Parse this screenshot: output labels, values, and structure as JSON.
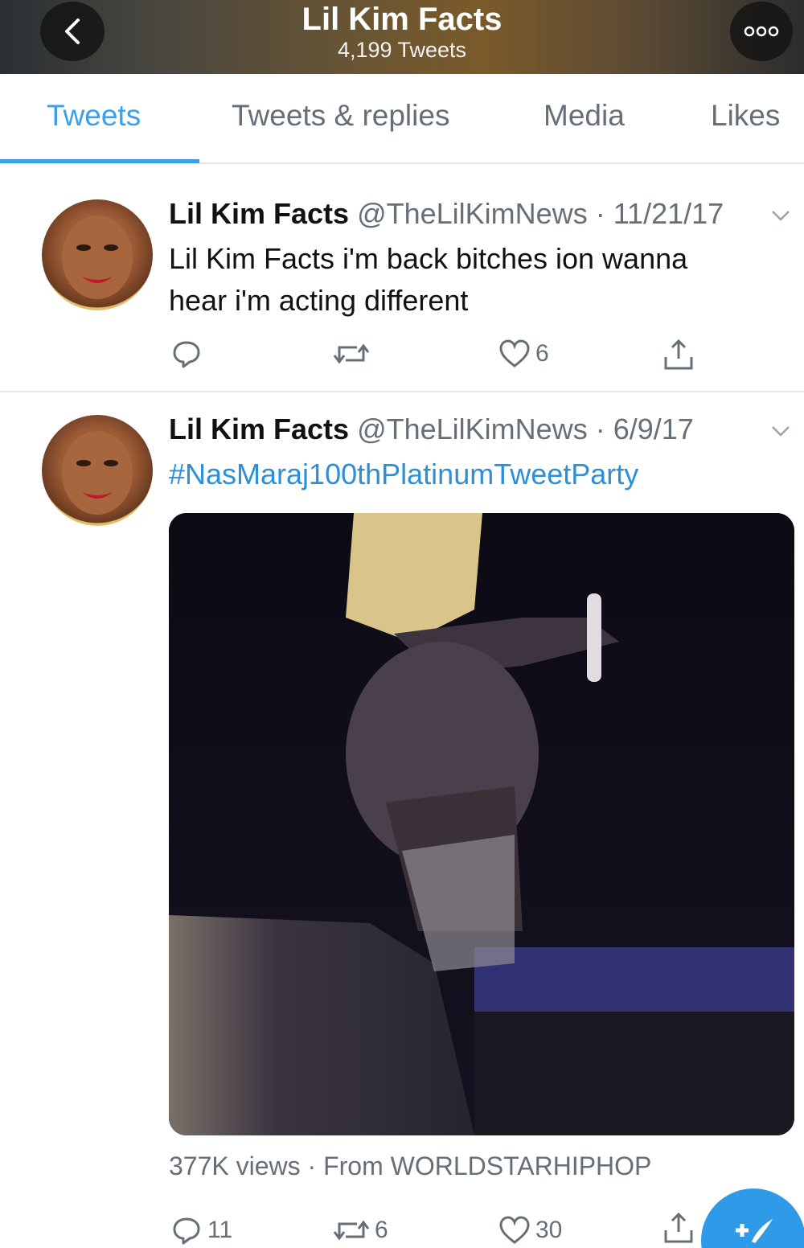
{
  "header": {
    "title": "Lil Kim Facts",
    "tweet_count": "4,199 Tweets"
  },
  "tabs": [
    {
      "label": "Tweets",
      "active": true
    },
    {
      "label": "Tweets & replies",
      "active": false
    },
    {
      "label": "Media",
      "active": false
    },
    {
      "label": "Likes",
      "active": false
    }
  ],
  "tweets": [
    {
      "name": "Lil Kim Facts",
      "handle": "@TheLilKimNews",
      "date": "11/21/17",
      "text_line1": "Lil Kim Facts i'm back bitches ion wanna",
      "text_line2": "hear i'm acting different",
      "replies": "",
      "retweets": "",
      "likes": "6"
    },
    {
      "name": "Lil Kim Facts",
      "handle": "@TheLilKimNews",
      "date": "6/9/17",
      "hashtag": "#NasMaraj100thPlatinumTweetParty",
      "views": "377K views",
      "source": "From WORLDSTARHIPHOP",
      "replies": "11",
      "retweets": "6",
      "likes": "30"
    }
  ],
  "colors": {
    "accent": "#3aa0e8",
    "hashtag": "#2b8fd9",
    "muted": "#666f77"
  },
  "icons": [
    "chevron-left-icon",
    "more-icon",
    "reply-icon",
    "retweet-icon",
    "heart-icon",
    "share-icon",
    "chevron-down-icon",
    "compose-icon"
  ]
}
